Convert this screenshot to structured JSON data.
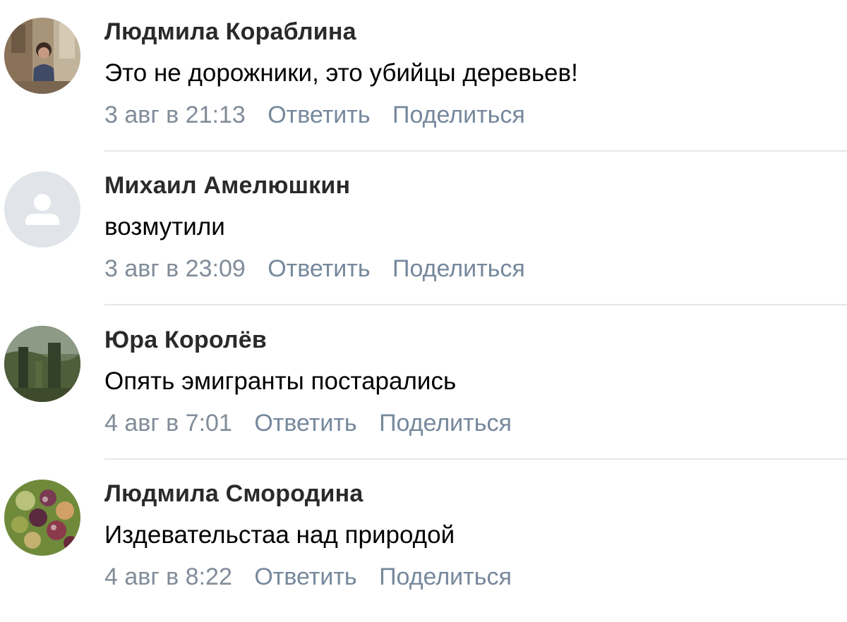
{
  "comments": [
    {
      "author": "Людмила Кораблина",
      "text": "Это не дорожники, это убийцы деревьев!",
      "date": "3 авг в 21:13",
      "reply_label": "Ответить",
      "share_label": "Поделиться",
      "avatar": "photo-woman"
    },
    {
      "author": "Михаил Амелюшкин",
      "text": "возмутили",
      "date": "3 авг в 23:09",
      "reply_label": "Ответить",
      "share_label": "Поделиться",
      "avatar": "default-user-icon"
    },
    {
      "author": "Юра Королёв",
      "text": "Опять эмигранты постарались",
      "date": "4 авг в 7:01",
      "reply_label": "Ответить",
      "share_label": "Поделиться",
      "avatar": "photo-landscape"
    },
    {
      "author": "Людмила Смородина",
      "text": "Издевательстаа над природой",
      "date": "4 авг в 8:22",
      "reply_label": "Ответить",
      "share_label": "Поделиться",
      "avatar": "photo-berries"
    }
  ],
  "colors": {
    "author": "#2a2a2a",
    "meta": "#818c99",
    "link": "#76889c",
    "divider": "#e4e6ea"
  }
}
